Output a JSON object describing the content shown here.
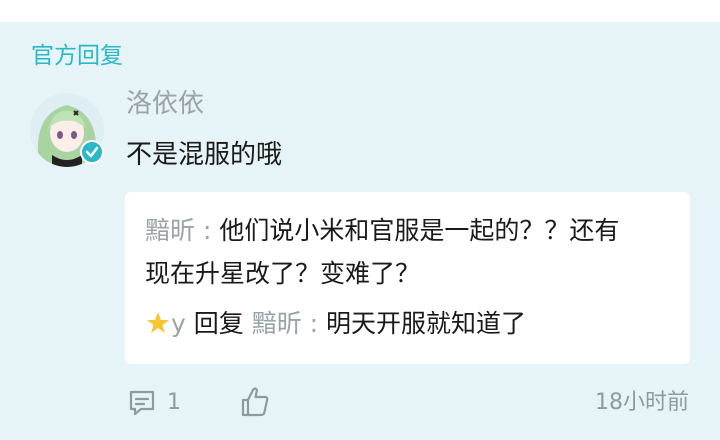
{
  "section_label": "官方回复",
  "post": {
    "username": "洛依依",
    "comment": "不是混服的哦"
  },
  "reply": {
    "quoted_user": "黯昕",
    "separator": " : ",
    "quoted_text_line1": "他们说小米和官服是一起的？？还有",
    "quoted_text_line2": "现在升星改了？变难了？",
    "replier_name": "y",
    "reply_word": " 回复 ",
    "target_user": "黯昕",
    "reply_text": "明天开服就知道了"
  },
  "footer": {
    "comment_count": "1",
    "time_ago": "18小时前"
  },
  "icons": {
    "comment": "comment-icon",
    "like": "thumbs-up-icon",
    "star": "star-emoji-icon",
    "verified": "verified-badge-icon"
  },
  "colors": {
    "accent": "#2bb8c8",
    "panel_bg": "#e6f4f8",
    "muted_text": "#9aa4a8"
  }
}
